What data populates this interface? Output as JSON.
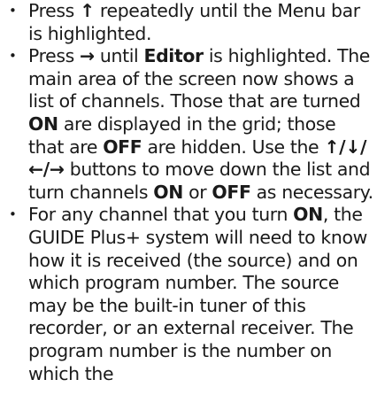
{
  "bullet_char": "•",
  "arrows": {
    "up": "↑",
    "down": "↓",
    "left": "←",
    "right": "→"
  },
  "item1": {
    "t1": "Press ",
    "t2": " repeatedly until the Menu bar is highlighted."
  },
  "item2": {
    "t1": "Press ",
    "t2": " until ",
    "editor": "Editor",
    "t3": " is highlighted. The main area of the screen now shows a list of channels. Those that are turned ",
    "on": "ON",
    "t4": " are displayed in the grid; those that are ",
    "off": "OFF",
    "t5": " are hidden. Use the ",
    "slash": "/",
    "t6": " buttons to move down the list and turn channels ",
    "on2": "ON",
    "t7": " or ",
    "off2": "OFF",
    "t8": " as necessary."
  },
  "item3": {
    "t1": "For any channel that you turn ",
    "on": "ON",
    "t2": ", the GUIDE Plus+ system will need to know how it is received (the source) and on which program number. The source may be the built-in tuner of this recorder, or an external receiver. The program number is the number on which the"
  }
}
